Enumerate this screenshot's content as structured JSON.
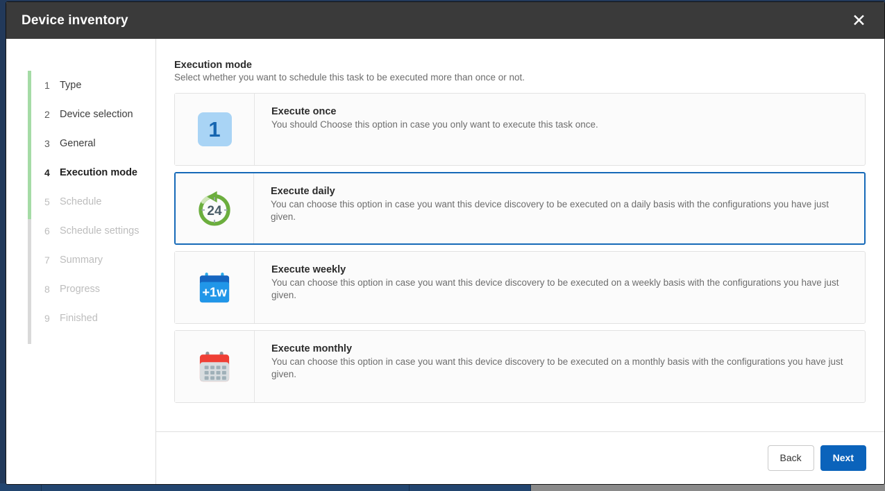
{
  "window": {
    "title": "Device inventory",
    "close_label": "✕"
  },
  "sidebar": {
    "steps": [
      {
        "num": "1",
        "label": "Type",
        "state": "done"
      },
      {
        "num": "2",
        "label": "Device selection",
        "state": "done"
      },
      {
        "num": "3",
        "label": "General",
        "state": "done"
      },
      {
        "num": "4",
        "label": "Execution mode",
        "state": "current"
      },
      {
        "num": "5",
        "label": "Schedule",
        "state": "disabled"
      },
      {
        "num": "6",
        "label": "Schedule settings",
        "state": "disabled"
      },
      {
        "num": "7",
        "label": "Summary",
        "state": "disabled"
      },
      {
        "num": "8",
        "label": "Progress",
        "state": "disabled"
      },
      {
        "num": "9",
        "label": "Finished",
        "state": "disabled"
      }
    ],
    "track_color": "#d9d9d9",
    "progress_color": "#a5dba6"
  },
  "main": {
    "title": "Execution mode",
    "subtitle": "Select whether you want to schedule this task to be executed more than once or not.",
    "options": [
      {
        "id": "execute-once",
        "icon": "number-one-icon",
        "icon_text": "1",
        "title": "Execute once",
        "description": "You should Choose this option in case you only want to execute this task once.",
        "selected": false
      },
      {
        "id": "execute-daily",
        "icon": "24-hour-refresh-icon",
        "icon_text": "24",
        "title": "Execute daily",
        "description": "You can choose this option in case you want this device discovery to be executed on a daily basis with the configurations you have just given.",
        "selected": true
      },
      {
        "id": "execute-weekly",
        "icon": "calendar-plus-one-week-icon",
        "icon_text": "+1w",
        "title": "Execute weekly",
        "description": "You can choose this option in case you want this device discovery to be executed on a weekly basis with the configurations you have just given.",
        "selected": false
      },
      {
        "id": "execute-monthly",
        "icon": "calendar-month-icon",
        "icon_text": "",
        "title": "Execute monthly",
        "description": "You can choose this option in case you want this device discovery to be executed on a monthly basis with the configurations you have just given.",
        "selected": false
      }
    ]
  },
  "footer": {
    "back_label": "Back",
    "next_label": "Next"
  },
  "colors": {
    "titlebar": "#3a3a3a",
    "selected_border": "#1569b8",
    "primary_button": "#0b63bb",
    "progress_green": "#a5dba6",
    "daily_icon_green": "#6cae3e",
    "weekly_icon_blue": "#1e95e0",
    "monthly_icon_red": "#ef3f35",
    "once_icon_blue": "#a9d4f5"
  }
}
